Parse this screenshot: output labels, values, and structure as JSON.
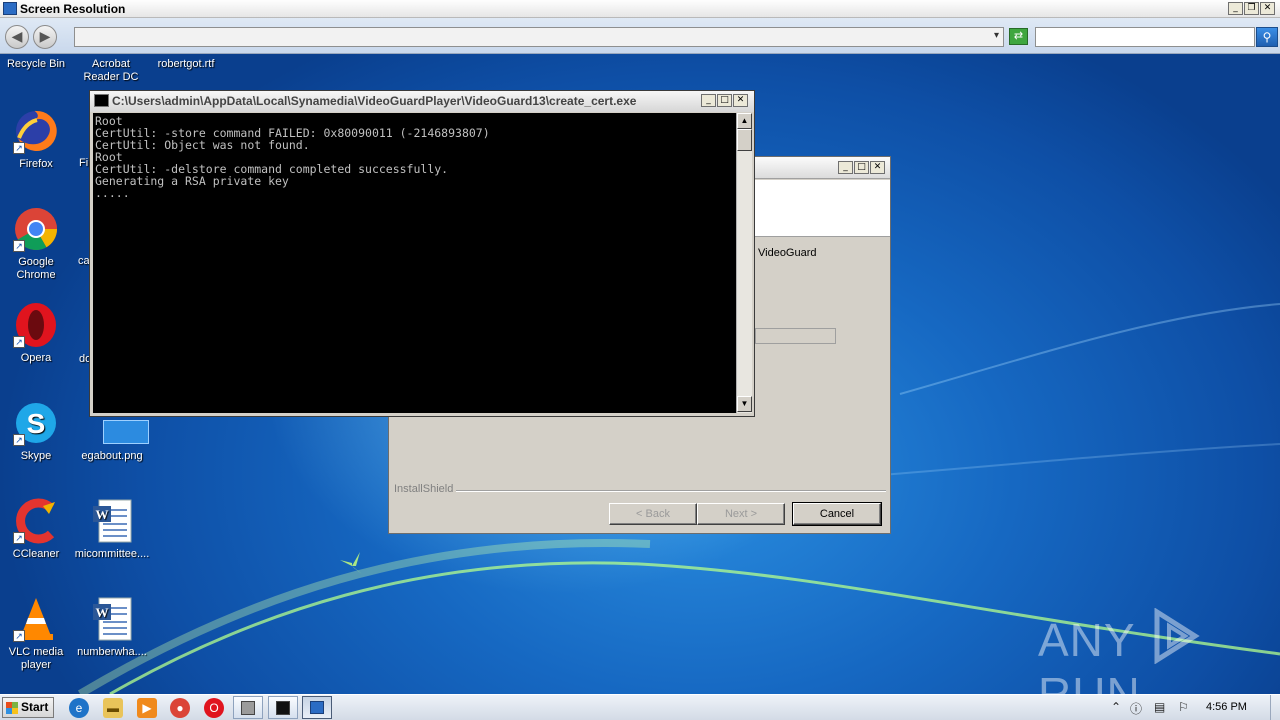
{
  "window": {
    "title": "Screen Resolution",
    "controls": {
      "minimize": "0",
      "restore": "2",
      "close": "r"
    }
  },
  "addressbar": {
    "address_value": "",
    "search_value": "",
    "dropdown_glyph": "▾"
  },
  "desktop": {
    "top_row_labels": [
      "Recycle Bin",
      "Acrobat Reader DC",
      "robertgot.rtf"
    ],
    "left_icons": [
      {
        "label": "Firefox",
        "icon": "firefox-icon"
      },
      {
        "label": "Google Chrome",
        "icon": "chrome-icon"
      },
      {
        "label": "Opera",
        "icon": "opera-icon"
      },
      {
        "label": "Skype",
        "icon": "skype-icon"
      },
      {
        "label": "CCleaner",
        "icon": "ccleaner-icon"
      },
      {
        "label": "VLC media player",
        "icon": "vlc-icon"
      }
    ],
    "second_column": [
      {
        "label": "egabout.png",
        "icon": "image-file-icon"
      },
      {
        "label": "micommittee....",
        "icon": "word-document-icon"
      },
      {
        "label": "numberwha....",
        "icon": "word-document-icon"
      }
    ],
    "partial_labels": [
      "Fi",
      "ca",
      "do"
    ]
  },
  "console": {
    "title": "C:\\Users\\admin\\AppData\\Local\\Synamedia\\VideoGuardPlayer\\VideoGuard13\\create_cert.exe",
    "lines": [
      "Root",
      "CertUtil: -store command FAILED: 0x80090011 (-2146893807)",
      "CertUtil: Object was not found.",
      "Root",
      "CertUtil: -delstore command completed successfully.",
      "Generating a RSA private key",
      "....."
    ]
  },
  "installer": {
    "partial_text": "VideoGuard",
    "footer_brand": "InstallShield",
    "buttons": {
      "back": "< Back",
      "next": "Next >",
      "cancel": "Cancel"
    },
    "progress": 0
  },
  "taskbar": {
    "start_label": "Start",
    "clock": "4:56 PM",
    "pinned": [
      "ie-icon",
      "explorer-folder-icon",
      "media-player-icon",
      "chrome-icon",
      "opera-icon"
    ],
    "tasks": [
      "installer-task",
      "console-task",
      "screen-resolution-task"
    ]
  },
  "watermark": {
    "left": "ANY",
    "right": "RUN"
  }
}
